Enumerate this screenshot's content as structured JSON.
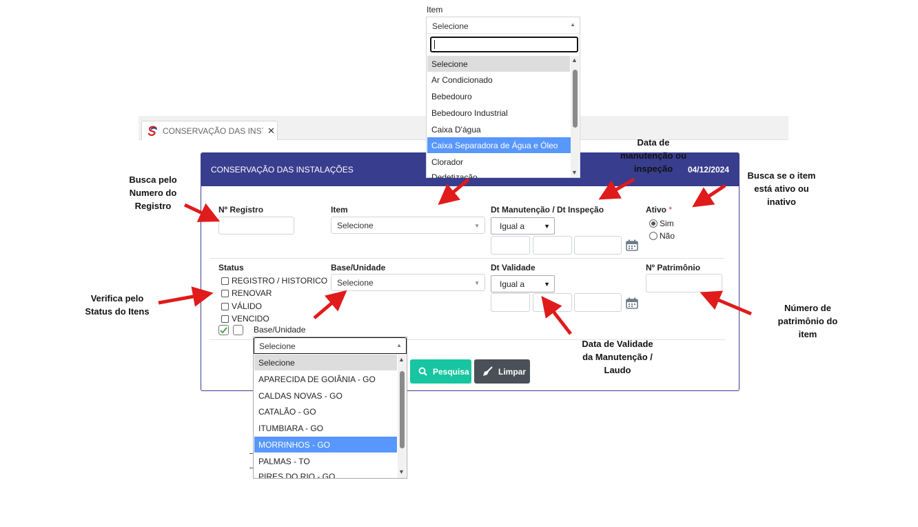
{
  "tab": {
    "label": "CONSERVAÇÃO DAS INST...",
    "close": "✕"
  },
  "panel": {
    "title": "CONSERVAÇÃO DAS INSTALAÇÕES",
    "date": "04/12/2024"
  },
  "form": {
    "registro_label": "Nº Registro",
    "item_label": "Item",
    "item_value": "Selecione",
    "dt_manut_label": "Dt Manutenção / Dt Inspeção",
    "dt_manut_op": "Igual a",
    "ativo_label": "Ativo",
    "ativo_req": "*",
    "ativo_sim": "Sim",
    "ativo_nao": "Não",
    "status_label": "Status",
    "status_options": [
      "REGISTRO / HISTORICO",
      "RENOVAR",
      "VÁLIDO",
      "VENCIDO"
    ],
    "base_label": "Base/Unidade",
    "base_value": "Selecione",
    "dt_validade_label": "Dt Validade",
    "dt_validade_op": "Igual a",
    "patrimonio_label": "Nº Patrimônio",
    "pesquisa": "Pesquisa",
    "limpar": "Limpar"
  },
  "item_dropdown": {
    "label": "Item",
    "selected": "Selecione",
    "options": [
      "Selecione",
      "Ar Condicionado",
      "Bebedouro",
      "Bebedouro Industrial",
      "Caixa D'água",
      "Caixa Separadora de Água e Óleo",
      "Clorador",
      "Dedetização"
    ],
    "highlighted_index": 5
  },
  "base_dropdown": {
    "label": "Base/Unidade",
    "selected": "Selecione",
    "options": [
      "Selecione",
      "APARECIDA DE GOIÂNIA - GO",
      "CALDAS NOVAS - GO",
      "CATALÃO - GO",
      "ITUMBIARA - GO",
      "MORRINHOS - GO",
      "PALMAS - TO",
      "PIRES DO RIO - GO"
    ],
    "highlighted_index": 5
  },
  "annotations": {
    "busca_registro": "Busca pelo\nNumero do\nRegistro",
    "data_manutencao": "Data de\nmanutenção ou\ninspeção",
    "busca_ativo": "Busca se o item\nestá ativo ou\ninativo",
    "verifica_status": "Verifica pelo\nStatus do Itens",
    "numero_patrimonio": "Número de\npatrimônio do\nitem",
    "data_validade": "Data de Validade\nda Manutenção /\nLaudo"
  },
  "colors": {
    "header": "#393d8e",
    "pesquisa": "#17c6a0",
    "limpar": "#4a5058",
    "highlight": "#5897fb",
    "arrow": "#e01b1b"
  }
}
